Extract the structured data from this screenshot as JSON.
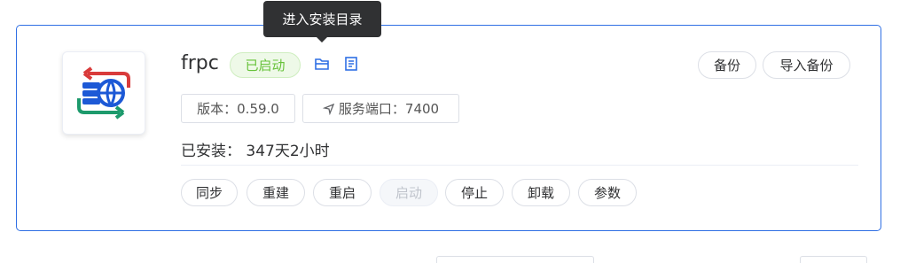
{
  "tooltip": {
    "text": "进入安装目录"
  },
  "app": {
    "name": "frpc",
    "status": "已启动",
    "version": "版本：0.59.0",
    "port": "服务端口：7400",
    "installed": "已安装：  347天2小时",
    "colors": {
      "status_green": "#67c23a",
      "border_blue": "#2f6fe4",
      "icon_blue": "#1d59d6",
      "icon_red": "#d93b3b",
      "icon_green": "#1d9a6c"
    }
  },
  "header_buttons": {
    "backup": "备份",
    "import_backup": "导入备份"
  },
  "actions": {
    "sync": "同步",
    "rebuild": "重建",
    "restart": "重启",
    "start": "启动",
    "stop": "停止",
    "uninstall": "卸载",
    "params": "参数"
  },
  "icons": [
    "app-logo-icon",
    "folder-icon",
    "document-icon",
    "send-arrow-icon"
  ]
}
